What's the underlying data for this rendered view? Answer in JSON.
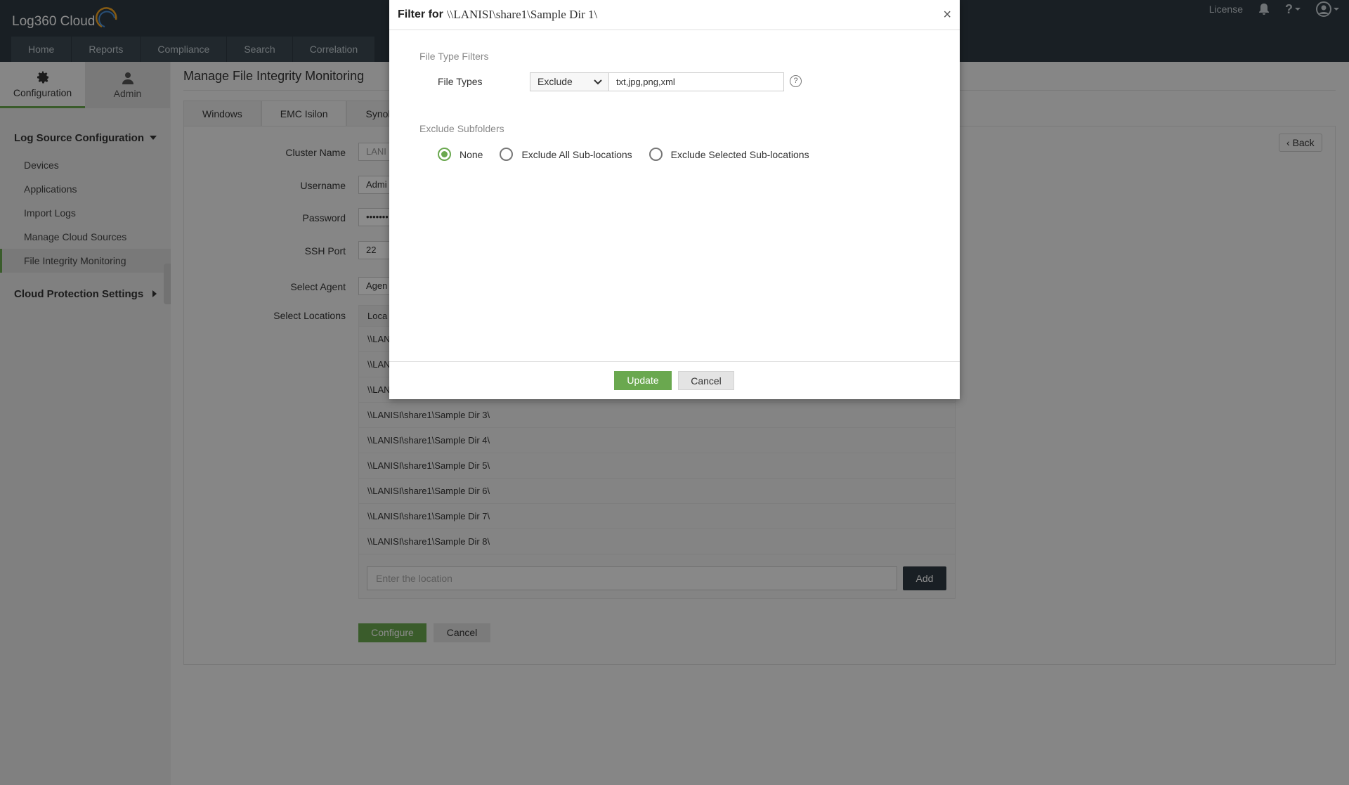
{
  "app": {
    "logo_text": "Log360 Cloud",
    "license_label": "License",
    "help_glyph": "?"
  },
  "nav": {
    "tabs": [
      "Home",
      "Reports",
      "Compliance",
      "Search",
      "Correlation"
    ]
  },
  "sidebar": {
    "tabs": [
      {
        "label": "Configuration",
        "icon": "gear-icon"
      },
      {
        "label": "Admin",
        "icon": "user-icon"
      }
    ],
    "section1_title": "Log Source Configuration",
    "items": [
      "Devices",
      "Applications",
      "Import Logs",
      "Manage Cloud Sources",
      "File Integrity Monitoring"
    ],
    "section2_title": "Cloud Protection Settings"
  },
  "main": {
    "title": "Manage File Integrity Monitoring",
    "tabs": [
      "Windows",
      "EMC Isilon",
      "Synolo"
    ],
    "back_label": "Back",
    "fields": {
      "cluster_name_label": "Cluster Name",
      "cluster_name_value": "LANI",
      "username_label": "Username",
      "username_value": "Admi",
      "password_label": "Password",
      "password_value": "•••••••",
      "ssh_port_label": "SSH Port",
      "ssh_port_value": "22",
      "select_agent_label": "Select Agent",
      "select_agent_value": "Agen",
      "select_locations_label": "Select Locations"
    },
    "locations_header": "Loca",
    "locations": [
      "\\\\LAN",
      "\\\\LAN",
      "\\\\LAN",
      "\\\\LANISI\\share1\\Sample Dir 3\\",
      "\\\\LANISI\\share1\\Sample Dir 4\\",
      "\\\\LANISI\\share1\\Sample Dir 5\\",
      "\\\\LANISI\\share1\\Sample Dir 6\\",
      "\\\\LANISI\\share1\\Sample Dir 7\\",
      "\\\\LANISI\\share1\\Sample Dir 8\\"
    ],
    "location_placeholder": "Enter the location",
    "add_label": "Add",
    "configure_label": "Configure",
    "cancel_label": "Cancel"
  },
  "modal": {
    "title": "Filter for",
    "path": "\\\\LANISI\\share1\\Sample Dir 1\\",
    "close": "×",
    "file_type_filters_label": "File Type Filters",
    "file_types_label": "File Types",
    "filter_mode": "Exclude",
    "file_types_value": "txt,jpg,png,xml",
    "help": "?",
    "exclude_subfolders_label": "Exclude Subfolders",
    "radio_options": [
      "None",
      "Exclude All Sub-locations",
      "Exclude Selected Sub-locations"
    ],
    "selected_option": "None",
    "update_label": "Update",
    "cancel_label": "Cancel"
  },
  "colors": {
    "header_bg": "#2e3a43",
    "accent_green": "#6aa84f"
  }
}
